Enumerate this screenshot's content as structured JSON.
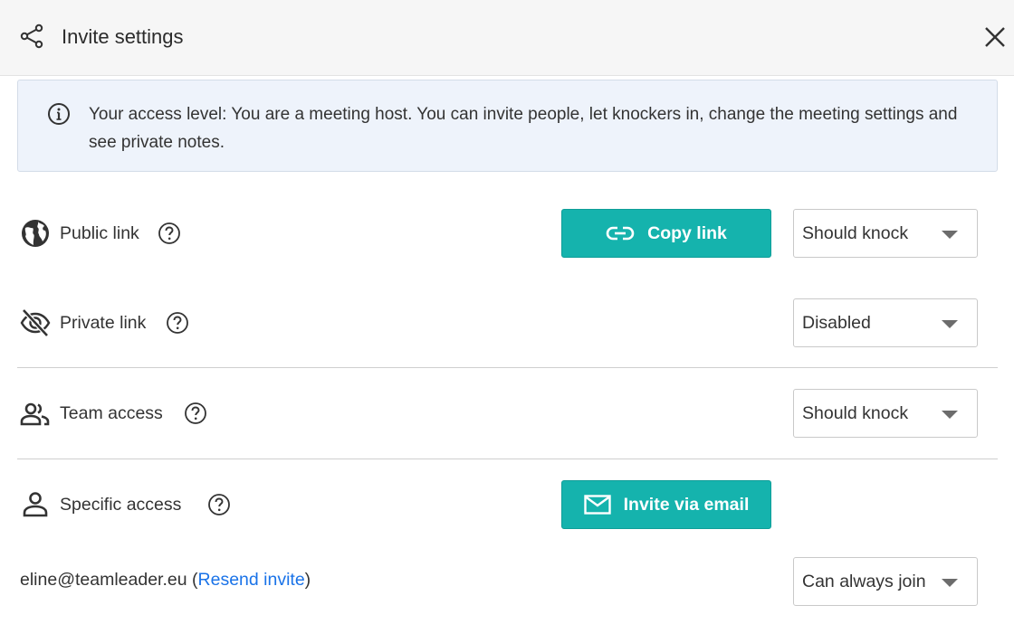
{
  "header": {
    "title": "Invite settings",
    "icon": "share-icon",
    "close_icon": "close-icon"
  },
  "info": {
    "icon": "info-icon",
    "text": "Your access level: You are a meeting host. You can invite people, let knockers in, change the meeting settings and see private notes."
  },
  "rows": {
    "public_link": {
      "icon": "globe-icon",
      "label": "Public link",
      "button_label": "Copy link",
      "button_icon": "link-icon",
      "select_value": "Should knock"
    },
    "private_link": {
      "icon": "eye-off-icon",
      "label": "Private link",
      "select_value": "Disabled"
    },
    "team_access": {
      "icon": "team-icon",
      "label": "Team access",
      "select_value": "Should knock"
    },
    "specific_access": {
      "icon": "person-icon",
      "label": "Specific access",
      "button_label": "Invite via email",
      "button_icon": "envelope-icon"
    }
  },
  "invitee": {
    "email": "eline@teamleader.eu",
    "paren_open": "(",
    "resend_label": "Resend invite",
    "paren_close": ")",
    "select_value": "Can always join"
  },
  "colors": {
    "accent": "#15b3ad",
    "link": "#1a73e8",
    "info_bg": "#eef3fb"
  }
}
